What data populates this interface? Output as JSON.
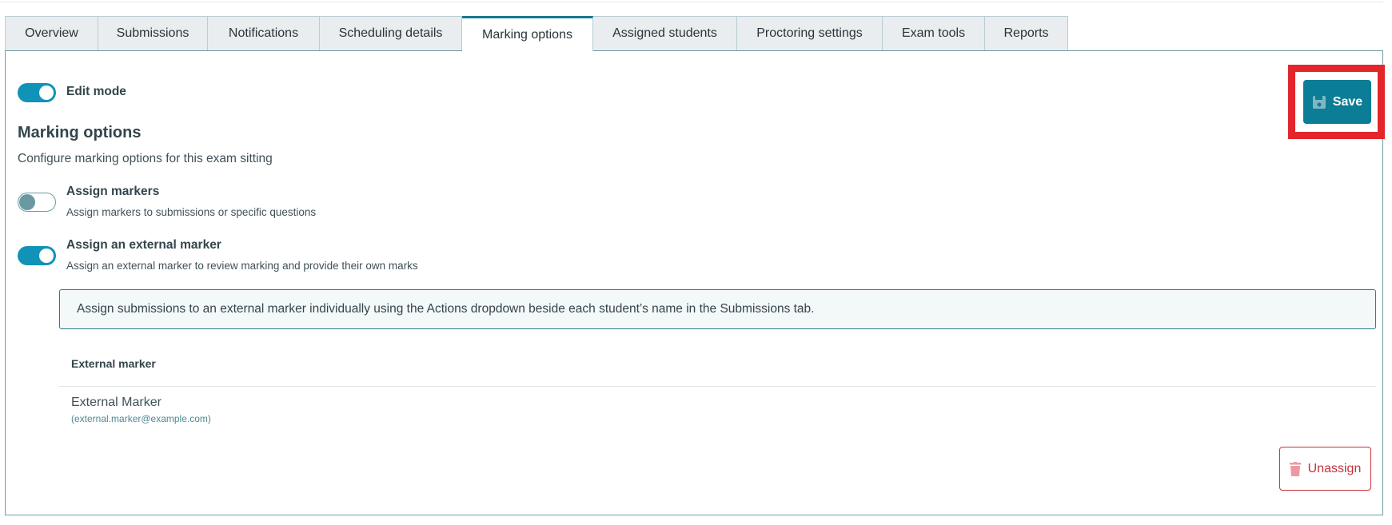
{
  "tabs": [
    {
      "label": "Overview",
      "active": false
    },
    {
      "label": "Submissions",
      "active": false
    },
    {
      "label": "Notifications",
      "active": false
    },
    {
      "label": "Scheduling details",
      "active": false
    },
    {
      "label": "Marking options",
      "active": true
    },
    {
      "label": "Assigned students",
      "active": false
    },
    {
      "label": "Proctoring settings",
      "active": false
    },
    {
      "label": "Exam tools",
      "active": false
    },
    {
      "label": "Reports",
      "active": false
    }
  ],
  "edit_mode": {
    "label": "Edit mode",
    "on": true
  },
  "save_label": "Save",
  "section": {
    "title": "Marking options",
    "description": "Configure marking options for this exam sitting"
  },
  "options": [
    {
      "label": "Assign markers",
      "description": "Assign markers to submissions or specific questions",
      "on": false
    },
    {
      "label": "Assign an external marker",
      "description": "Assign an external marker to review marking and provide their own marks",
      "on": true
    }
  ],
  "info_message": "Assign submissions to an external marker individually using the Actions dropdown beside each student’s name in the Submissions tab.",
  "table": {
    "header": "External marker",
    "rows": [
      {
        "name": "External Marker",
        "email": "(external.marker@example.com)"
      }
    ]
  },
  "unassign_label": "Unassign",
  "colors": {
    "accent": "#1093b6",
    "save": "#0b7d96",
    "danger": "#c6303b",
    "highlight": "#e3262b"
  }
}
